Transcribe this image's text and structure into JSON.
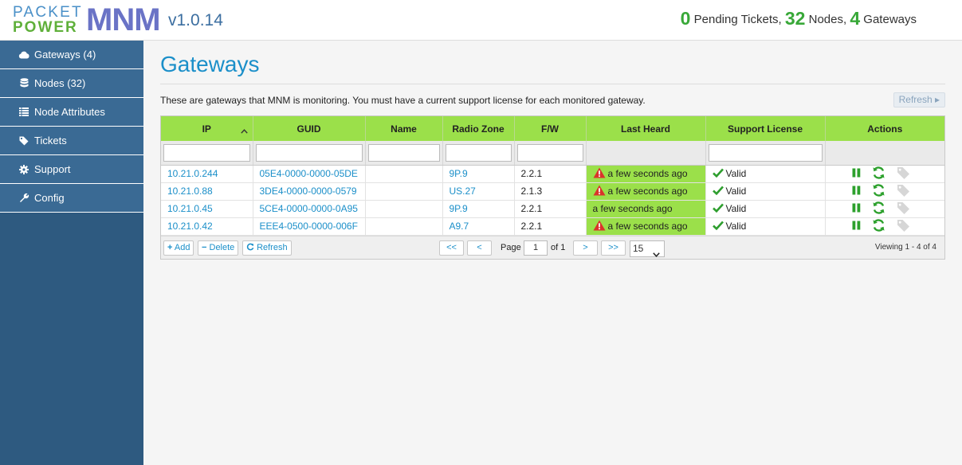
{
  "header": {
    "logo_line1": "PACKET",
    "logo_line2": "POWER",
    "logo_mnm": "MNM",
    "version": "v1.0.14",
    "pending_count": "0",
    "pending_label": "Pending Tickets,",
    "nodes_count": "32",
    "nodes_label": "Nodes,",
    "gateways_count": "4",
    "gateways_label": "Gateways"
  },
  "sidebar": {
    "items": [
      {
        "label": "Gateways (4)",
        "icon": "cloud-icon"
      },
      {
        "label": "Nodes (32)",
        "icon": "database-icon"
      },
      {
        "label": "Node Attributes",
        "icon": "list-icon"
      },
      {
        "label": "Tickets",
        "icon": "tag-icon"
      },
      {
        "label": "Support",
        "icon": "gear-icon"
      },
      {
        "label": "Config",
        "icon": "wrench-icon"
      }
    ]
  },
  "main": {
    "title": "Gateways",
    "description": "These are gateways that MNM is monitoring. You must have a current support license for each monitored gateway.",
    "refresh_top": "Refresh ▸"
  },
  "table": {
    "columns": [
      "IP",
      "GUID",
      "Name",
      "Radio Zone",
      "F/W",
      "Last Heard",
      "Support License",
      "Actions"
    ],
    "rows": [
      {
        "ip": "10.21.0.244",
        "guid": "05E4-0000-0000-05DE",
        "name": "",
        "zone": "9P.9",
        "fw": "2.2.1",
        "heard": "a few seconds ago",
        "warn": true,
        "license": "Valid"
      },
      {
        "ip": "10.21.0.88",
        "guid": "3DE4-0000-0000-0579",
        "name": "",
        "zone": "US.27",
        "fw": "2.1.3",
        "heard": "a few seconds ago",
        "warn": true,
        "license": "Valid"
      },
      {
        "ip": "10.21.0.45",
        "guid": "5CE4-0000-0000-0A95",
        "name": "",
        "zone": "9P.9",
        "fw": "2.2.1",
        "heard": "a few seconds ago",
        "warn": false,
        "license": "Valid"
      },
      {
        "ip": "10.21.0.42",
        "guid": "EEE4-0500-0000-006F",
        "name": "",
        "zone": "A9.7",
        "fw": "2.2.1",
        "heard": "a few seconds ago",
        "warn": true,
        "license": "Valid"
      }
    ]
  },
  "pager": {
    "add": "Add",
    "delete": "Delete",
    "refresh": "Refresh",
    "first": "<<",
    "prev": "<",
    "next": ">",
    "last": ">>",
    "page_label": "Page",
    "page_value": "1",
    "of_label": "of 1",
    "page_size": "15",
    "viewing": "Viewing 1 - 4 of 4"
  },
  "colors": {
    "accent": "#1b8fc9",
    "header_green": "#9be04a",
    "sidebar": "#2e5a80",
    "count_green": "#38a838",
    "warning": "#d9342b"
  }
}
